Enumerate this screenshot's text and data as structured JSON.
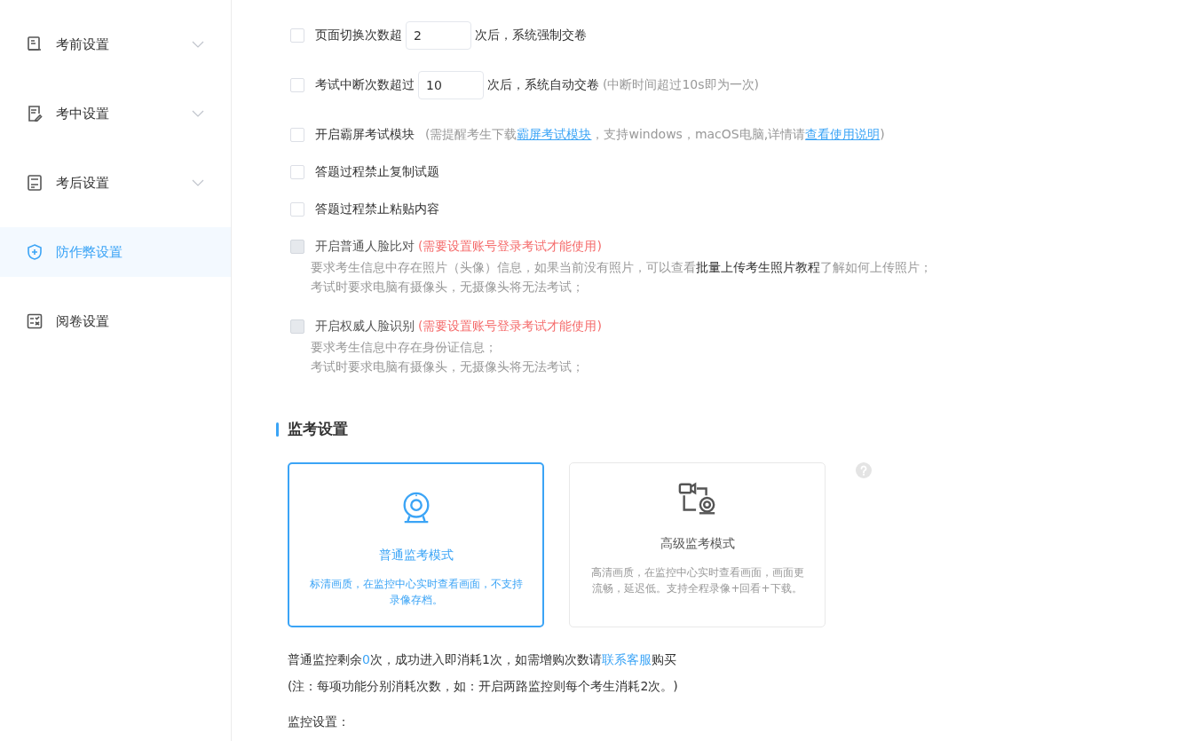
{
  "sidebar": {
    "items": [
      {
        "label": "考前设置",
        "selected": false,
        "expandable": true
      },
      {
        "label": "考中设置",
        "selected": false,
        "expandable": true
      },
      {
        "label": "考后设置",
        "selected": false,
        "expandable": true
      },
      {
        "label": "防作弊设置",
        "selected": true,
        "expandable": false
      },
      {
        "label": "阅卷设置",
        "selected": false,
        "expandable": false
      }
    ]
  },
  "options": [
    {
      "kind": "input",
      "checked": false,
      "disabled": false,
      "label": "页面切换次数超",
      "value": "2",
      "suffix": "次后，系统强制交卷"
    },
    {
      "kind": "input",
      "checked": false,
      "disabled": false,
      "label": "考试中断次数超过",
      "value": "10",
      "suffix": "次后，系统自动交卷",
      "note": "(中断时间超过10s即为一次)"
    },
    {
      "kind": "links",
      "checked": false,
      "disabled": false,
      "label": "开启霸屏考试模块",
      "note_before": "(需提醒考生下载",
      "download_link": "霸屏考试模块",
      "note_middle": "，支持windows，macOS电脑,详情请",
      "guide_link": "查看使用说明",
      "note_after": ")"
    },
    {
      "kind": "plain",
      "checked": false,
      "disabled": false,
      "label": "答题过程禁止复制试题"
    },
    {
      "kind": "plain",
      "checked": false,
      "disabled": false,
      "label": "答题过程禁止粘贴内容"
    },
    {
      "kind": "described",
      "checked": false,
      "disabled": true,
      "label": "开启普通人脸比对",
      "warning": "(需要设置账号登录考试才能使用)",
      "description": [
        "要求考生信息中存在照片（头像）信息，如果当前没有照片，可以查看**批量上传考生照片教程**了解如何上传照片；",
        "考试时要求电脑有摄像头，无摄像头将无法考试；"
      ]
    },
    {
      "kind": "described",
      "checked": false,
      "disabled": true,
      "label": "开启权威人脸识别",
      "warning": "(需要设置账号登录考试才能使用)",
      "description": [
        "要求考生信息中存在身份证信息；",
        "考试时要求电脑有摄像头，无摄像头将无法考试；"
      ]
    }
  ],
  "proctoring": {
    "title": "监考设置",
    "modes": [
      {
        "title": "普通监考模式",
        "description": "标清画质，在监控中心实时查看画面，不支持录像存档。",
        "selected": true
      },
      {
        "title": "高级监考模式",
        "description": "高清画质，在监控中心实时查看画面，画面更流畅，延迟低。支持全程录像+回看+下载。",
        "selected": false
      }
    ],
    "quota": {
      "before": "普通监控剩余",
      "count": "0",
      "middle": "次，成功进入即消耗1次，如需增购次数请",
      "link": "联系客服",
      "after": "购买"
    },
    "note": "(注：每项功能分别消耗次数，如：开启两路监控则每个考生消耗2次。)",
    "settings_label": "监控设置："
  }
}
